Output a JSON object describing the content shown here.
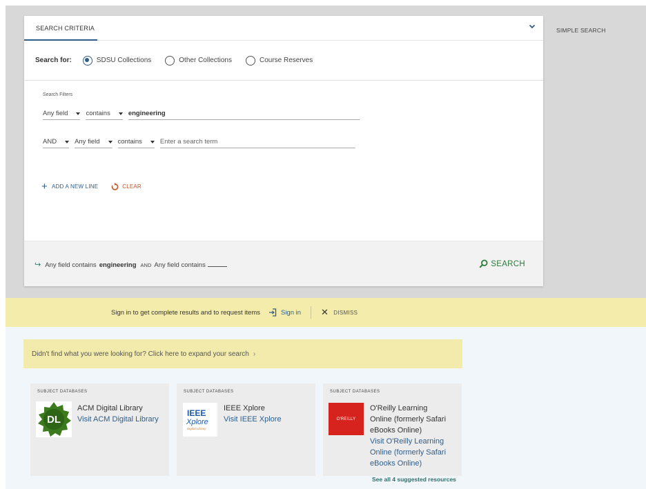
{
  "search_panel": {
    "tab_label": "SEARCH CRITERIA",
    "search_for_label": "Search for:",
    "scopes": [
      {
        "label": "SDSU Collections",
        "selected": true
      },
      {
        "label": "Other Collections",
        "selected": false
      },
      {
        "label": "Course Reserves",
        "selected": false
      }
    ],
    "filters_label": "Search Filters",
    "row1": {
      "field": "Any field",
      "operator": "contains",
      "term": "engineering"
    },
    "row2": {
      "boolean": "AND",
      "field": "Any field",
      "operator": "contains",
      "placeholder": "Enter a search term"
    },
    "add_line_label": "ADD A NEW LINE",
    "clear_label": "CLEAR",
    "summary": {
      "part1": "Any field",
      "part2": "contains",
      "term": "engineering",
      "bool": "AND",
      "part3": "Any field",
      "part4": "contains"
    },
    "search_button_label": "SEARCH"
  },
  "simple_search_label": "SIMPLE SEARCH",
  "signin_banner": {
    "message": "Sign in to get complete results and to request items",
    "signin_label": "Sign in",
    "dismiss_label": "DISMISS"
  },
  "expand_banner": {
    "text": "Didn't find what you were looking for? Click here to expand your search",
    "arrow": "›"
  },
  "resources": [
    {
      "heading": "SUBJECT DATABASES",
      "title": "ACM Digital Library",
      "link": "Visit ACM Digital Library",
      "logo": "DL"
    },
    {
      "heading": "SUBJECT DATABASES",
      "title": "IEEE Xplore",
      "link": "Visit IEEE Xplore",
      "logo_line1": "IEEE",
      "logo_line2": "Xplore",
      "logo_line3": "Digital Library"
    },
    {
      "heading": "SUBJECT DATABASES",
      "title_lines": [
        "O'Reilly Learning",
        "Online (formerly Safari",
        "eBooks Online)"
      ],
      "link_lines": [
        "Visit O'Reilly Learning",
        "Online (formerly Safari",
        "eBooks Online)"
      ],
      "logo": "O'REILLY"
    }
  ],
  "see_all_label": "See all 4 suggested resources",
  "colors": {
    "accent_blue": "#2f5d8a",
    "search_green": "#2b7a3a",
    "clear_orange": "#c0562b",
    "banner_yellow": "#f4ecaa",
    "oreilly_red": "#d7231e",
    "acm_green": "#3c7a1e"
  }
}
